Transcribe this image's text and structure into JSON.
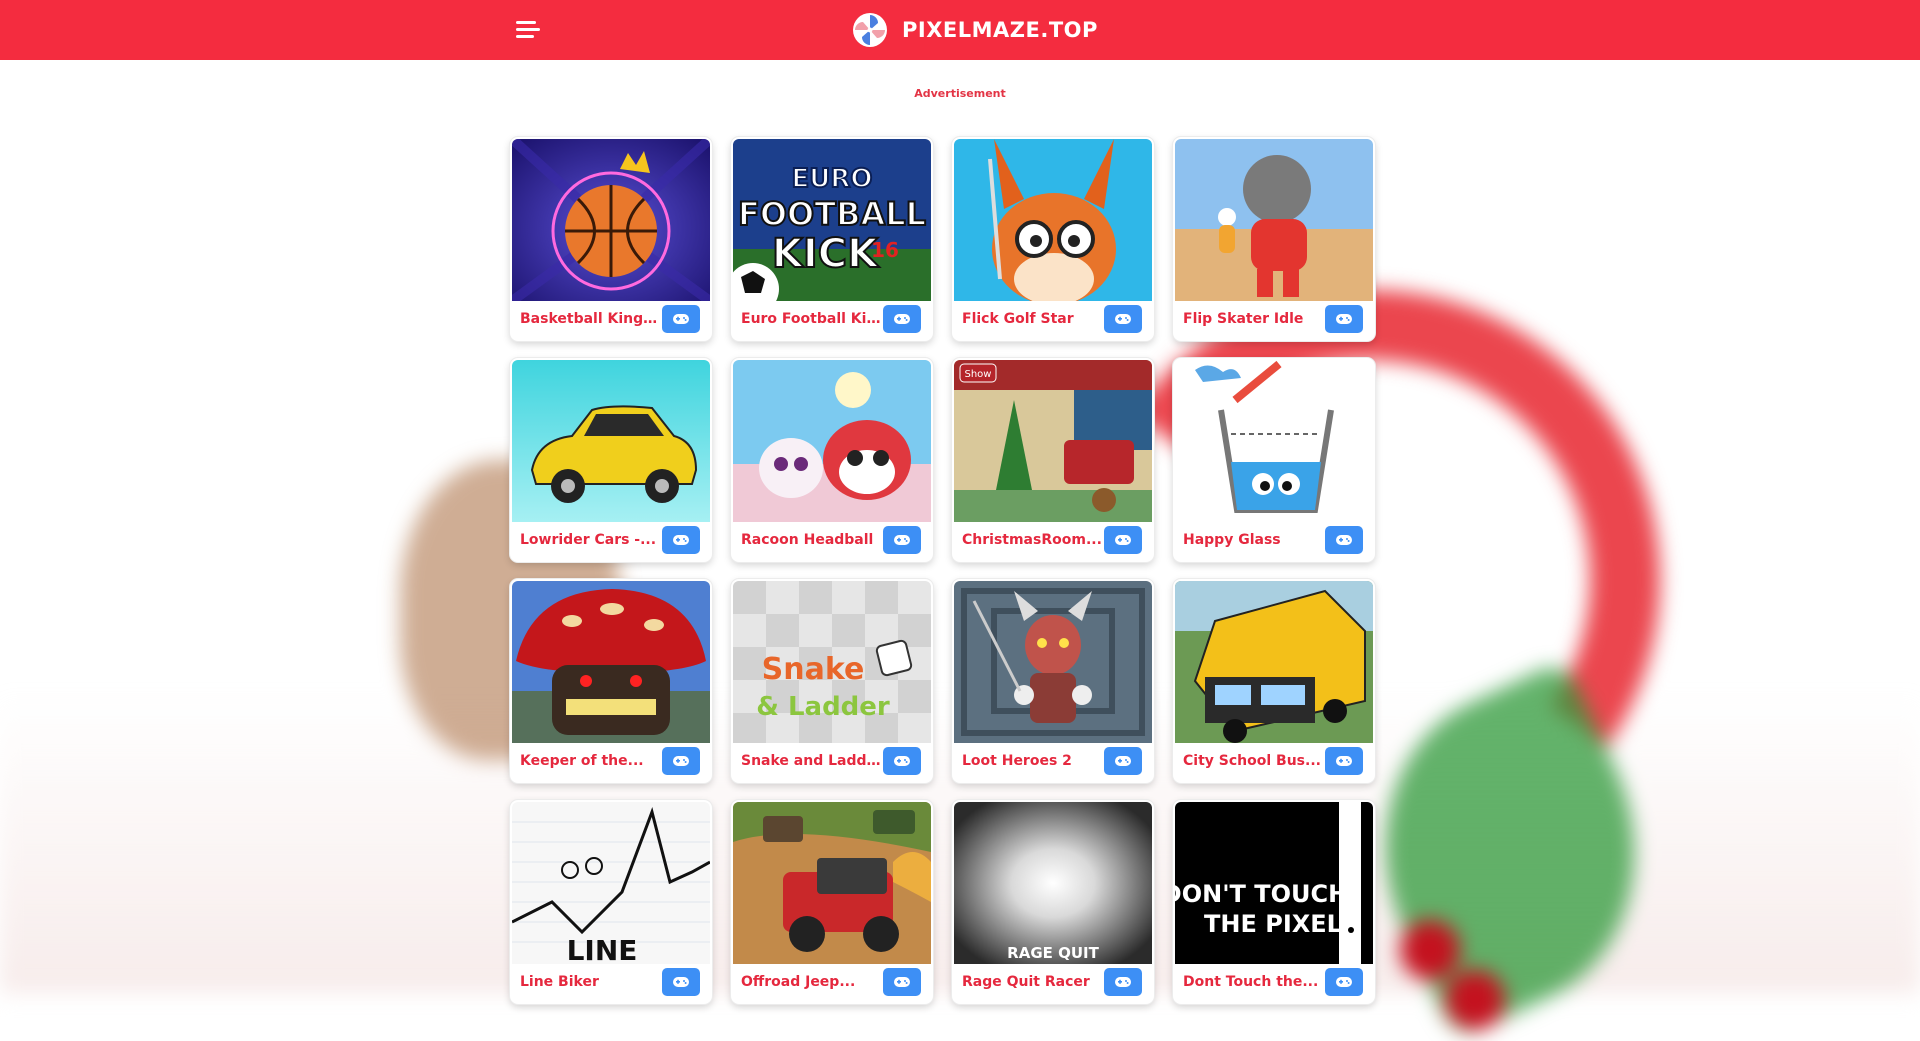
{
  "header": {
    "site_name": "PIXELMAZE.TOP",
    "menu_icon": "hamburger-icon",
    "logo_icon": "pinwheel-icon",
    "bg_color": "#f42c3f"
  },
  "ad": {
    "label": "Advertisement"
  },
  "play_icon": "gamepad-icon",
  "games": [
    {
      "title": "Basketball Kings..."
    },
    {
      "title": "Euro Football Kick"
    },
    {
      "title": "Flick Golf Star"
    },
    {
      "title": "Flip Skater Idle"
    },
    {
      "title": "Lowrider Cars -..."
    },
    {
      "title": "Racoon Headball"
    },
    {
      "title": "ChristmasRoom..."
    },
    {
      "title": "Happy Glass"
    },
    {
      "title": "Keeper of the..."
    },
    {
      "title": "Snake and Ladder"
    },
    {
      "title": "Loot Heroes 2"
    },
    {
      "title": "City School Bus..."
    },
    {
      "title": "Line Biker"
    },
    {
      "title": "Offroad Jeep..."
    },
    {
      "title": "Rage Quit Racer"
    },
    {
      "title": "Dont Touch the..."
    }
  ],
  "thumb_text": {
    "euro1": "EURO",
    "euro2": "FOOTBALL",
    "euro3": "KICK",
    "euro4": "16",
    "show": "Show",
    "snake1": "Snake",
    "snake2": "& Ladder",
    "linebiker": "LINE",
    "ragequit": "RAGE QUIT",
    "donttouch1": "DON'T TOUCH",
    "donttouch2": "THE PIXEL"
  }
}
